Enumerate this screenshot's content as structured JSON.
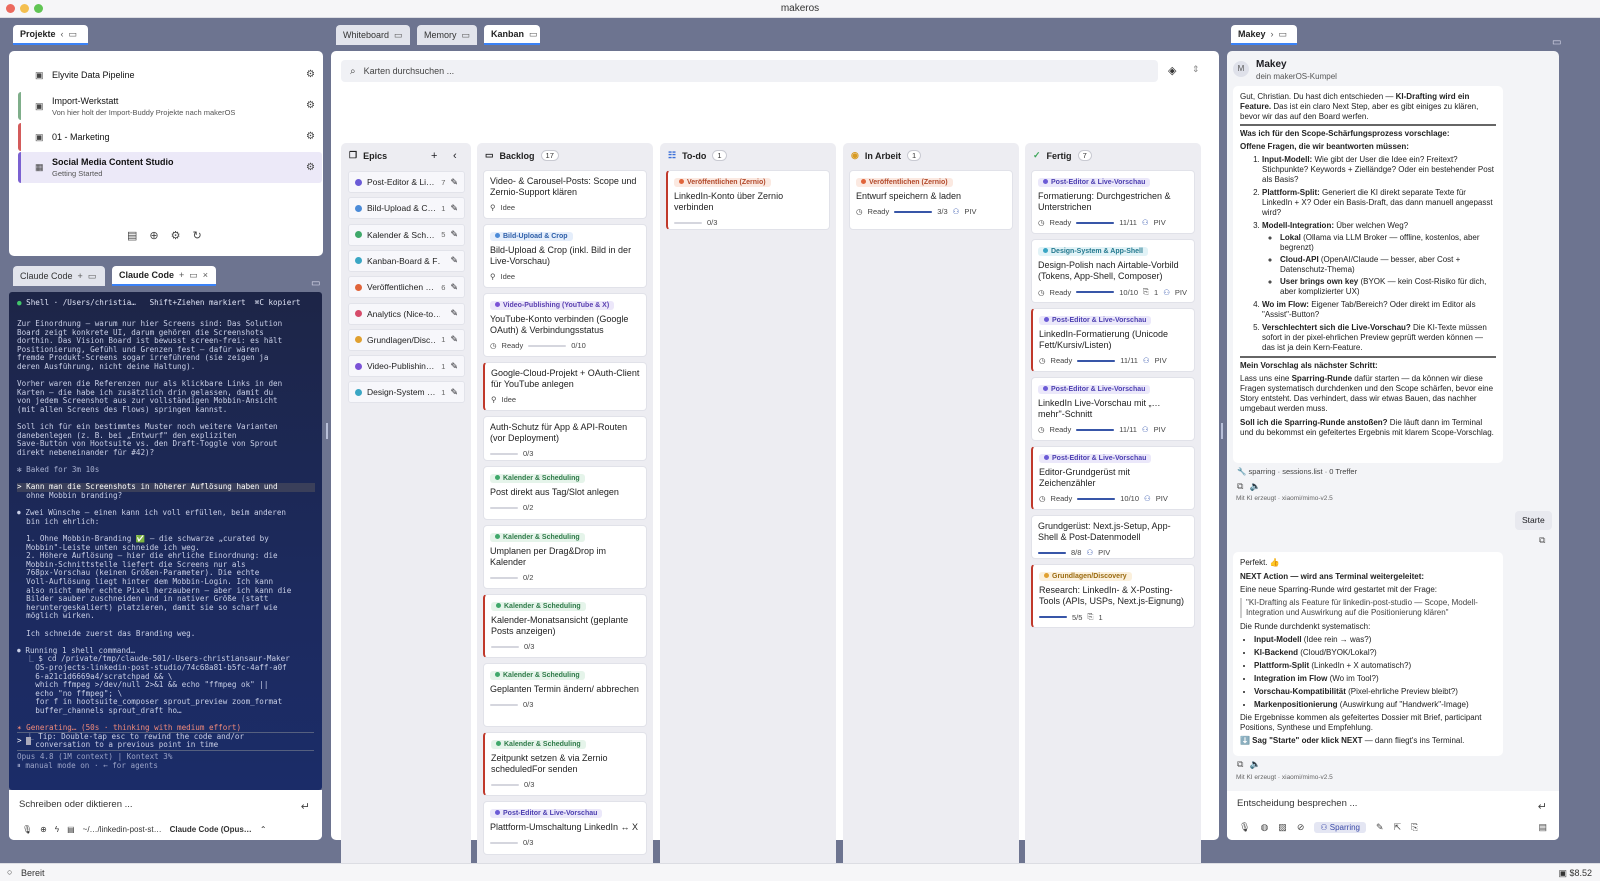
{
  "app": {
    "title": "makeros",
    "status": "Bereit",
    "cost": "$8.52"
  },
  "left": {
    "tab_label": "Projekte",
    "projects": [
      {
        "name": "Elyvite Data Pipeline",
        "sub": "",
        "color": ""
      },
      {
        "name": "Import-Werkstatt",
        "sub": "Von hier holt der Import-Buddy Projekte nach makerOS",
        "color": "#7fae8a"
      },
      {
        "name": "01 - Marketing",
        "sub": "",
        "color": "#d35b5b"
      },
      {
        "name": "Social Media Content Studio",
        "sub": "Getting Started",
        "color": "#7b61d1"
      }
    ],
    "term_tabs": [
      "Claude Code",
      "Claude Code"
    ],
    "terminal": {
      "header": "Shell · /Users/christia…   Shift+Ziehen markiert  ⌘C kopiert",
      "lines": [
        "Zur Einordnung — warum nur hier Screens sind: Das Solution",
        "Board zeigt konkrete UI, darum gehören die Screenshots",
        "dorthin. Das Vision Board ist bewusst screen-frei: es hält",
        "Positionierung, Gefühl und Grenzen fest — dafür wären",
        "fremde Produkt-Screens sogar irreführend (sie zeigen ja",
        "deren Ausführung, nicht deine Haltung).",
        "",
        "Vorher waren die Referenzen nur als klickbare Links in den",
        "Karten — die habe ich zusätzlich drin gelassen, damit du",
        "von jedem Screenshot aus zur vollständigen Mobbin-Ansicht",
        "(mit allen Screens des Flows) springen kannst.",
        "",
        "Soll ich für ein bestimmtes Muster noch weitere Varianten",
        "danebenlegen (z. B. bei „Entwurf\" den expliziten",
        "Save-Button von Hootsuite vs. den Draft-Toggle von Sprout",
        "direkt nebeneinander für #42)?",
        "",
        "✻ Baked for 3m 10s",
        "",
        "> Kann man die Screenshots in höherer Auflösung haben und",
        "  ohne Mobbin branding?",
        "",
        "⏺ Zwei Wünsche — einen kann ich voll erfüllen, beim anderen",
        "  bin ich ehrlich:",
        "",
        "  1. Ohne Mobbin-Branding ✅ — die schwarze „curated by",
        "  Mobbin\"-Leiste unten schneide ich weg.",
        "  2. Höhere Auflösung — hier die ehrliche Einordnung: die",
        "  Mobbin-Schnittstelle liefert die Screens nur als",
        "  768px-Vorschau (keinen Größen-Parameter). Die echte",
        "  Voll-Auflösung liegt hinter dem Mobbin-Login. Ich kann",
        "  also nicht mehr echte Pixel herzaubern — aber ich kann die",
        "  Bilder sauber zuschneiden und in nativer Größe (statt",
        "  heruntergeskaliert) platzieren, damit sie so scharf wie",
        "  möglich wirken.",
        "",
        "  Ich schneide zuerst das Branding weg.",
        "",
        "⏺ Running 1 shell command…",
        "  ⎿ $ cd /private/tmp/claude-501/-Users-christiansaur-Maker",
        "    OS-projects-linkedin-post-studio/74c68a81-b5fc-4aff-a0f",
        "    6-a21c1d6669a4/scratchpad && \\",
        "    which ffmpeg >/dev/null 2>&1 && echo \"ffmpeg ok\" ||",
        "    echo \"no ffmpeg\"; \\",
        "    for f in hootsuite_composer sprout_preview zoom_format",
        "    buffer_channels sprout_draft ho…",
        "",
        "✶ Generating… (50s · thinking with medium effort)",
        "  ⎿ Tip: Double-tap esc to rewind the code and/or",
        "    conversation to a previous point in time"
      ],
      "prompt": ">",
      "footer1": "Opus 4.8 (1M context) | Kontext 3%",
      "footer2": "⏸ manual mode on · ← for agents"
    },
    "input_placeholder": "Schreiben oder diktieren ...",
    "footer_path": "~/…/linkedin-post-st…",
    "footer_model": "Claude Code (Opus…"
  },
  "center": {
    "tabs": [
      "Whiteboard",
      "Memory",
      "Kanban"
    ],
    "search_placeholder": "Karten durchsuchen ...",
    "epics_title": "Epics",
    "epics": [
      {
        "name": "Post-Editor & Li…",
        "count": "7",
        "color": "#6b5bd6"
      },
      {
        "name": "Bild-Upload & C…",
        "count": "1",
        "color": "#4b8bd8"
      },
      {
        "name": "Kalender & Sch…",
        "count": "5",
        "color": "#3fa86a"
      },
      {
        "name": "Kanban-Board & F…",
        "count": "",
        "color": "#3aa6c4"
      },
      {
        "name": "Veröffentlichen …",
        "count": "6",
        "color": "#e0643a"
      },
      {
        "name": "Analytics (Nice-to…",
        "count": "",
        "color": "#d64b6a"
      },
      {
        "name": "Grundlagen/Disc…",
        "count": "1",
        "color": "#e0a030"
      },
      {
        "name": "Video-Publishin…",
        "count": "1",
        "color": "#7b52d6"
      },
      {
        "name": "Design-System …",
        "count": "1",
        "color": "#3aa6c4"
      }
    ],
    "columns": [
      {
        "title": "Backlog",
        "count": "17"
      },
      {
        "title": "To-do",
        "count": "1"
      },
      {
        "title": "In Arbeit",
        "count": "1"
      },
      {
        "title": "Fertig",
        "count": "7"
      }
    ],
    "backlog": [
      {
        "tag": "",
        "title": "Video- & Carousel-Posts: Scope und Zernio-Support klären",
        "meta": "Idee",
        "progress": ""
      },
      {
        "tag": "Bild-Upload & Crop",
        "title": "Bild-Upload & Crop (inkl. Bild in der Live-Vorschau)",
        "meta": "Idee",
        "progress": ""
      },
      {
        "tag": "Video-Publishing (YouTube & X)",
        "title": "YouTube-Konto verbinden (Google OAuth) & Verbindungsstatus",
        "meta": "Ready",
        "progress": "0/10"
      },
      {
        "tag": "",
        "title": "Google-Cloud-Projekt + OAuth-Client für YouTube anlegen",
        "meta": "Idee",
        "progress": ""
      },
      {
        "tag": "",
        "title": "Auth-Schutz für App & API-Routen (vor Deployment)",
        "meta": "",
        "progress": "0/3"
      },
      {
        "tag": "Kalender & Scheduling",
        "title": "Post direkt aus Tag/Slot anlegen",
        "meta": "",
        "progress": "0/2"
      },
      {
        "tag": "Kalender & Scheduling",
        "title": "Umplanen per Drag&Drop im Kalender",
        "meta": "",
        "progress": "0/2"
      },
      {
        "tag": "Kalender & Scheduling",
        "title": "Kalender-Monatsansicht (geplante Posts anzeigen)",
        "meta": "",
        "progress": "0/3"
      },
      {
        "tag": "Kalender & Scheduling",
        "title": "Geplanten Termin ändern/ abbrechen",
        "meta": "",
        "progress": "0/3"
      },
      {
        "tag": "Kalender & Scheduling",
        "title": "Zeitpunkt setzen & via Zernio scheduledFor senden",
        "meta": "",
        "progress": "0/3"
      },
      {
        "tag": "Post-Editor & Live-Vorschau",
        "title": "Plattform-Umschaltung LinkedIn ↔ X",
        "meta": "",
        "progress": "0/3"
      }
    ],
    "todo": [
      {
        "tag": "Veröffentlichen (Zernio)",
        "title": "LinkedIn-Konto über Zernio verbinden",
        "meta": "",
        "progress": "0/3"
      }
    ],
    "inarbeit": [
      {
        "tag": "Veröffentlichen (Zernio)",
        "title": "Entwurf speichern & laden",
        "meta": "Ready",
        "progress": "3/3",
        "extra": "PIV"
      }
    ],
    "fertig": [
      {
        "tag": "Post-Editor & Live-Vorschau",
        "title": "Formatierung: Durchgestrichen & Unterstrichen",
        "meta": "Ready",
        "progress": "11/11",
        "extra": "PIV"
      },
      {
        "tag": "Design-System & App-Shell",
        "title": "Design-Polish nach Airtable-Vorbild (Tokens, App-Shell, Composer)",
        "meta": "Ready",
        "progress": "10/10",
        "attach": "1",
        "extra": "PIV"
      },
      {
        "tag": "Post-Editor & Live-Vorschau",
        "title": "LinkedIn-Formatierung (Unicode Fett/Kursiv/Listen)",
        "meta": "Ready",
        "progress": "11/11",
        "extra": "PIV"
      },
      {
        "tag": "Post-Editor & Live-Vorschau",
        "title": "LinkedIn Live-Vorschau mit „… mehr\"-Schnitt",
        "meta": "Ready",
        "progress": "11/11",
        "extra": "PIV"
      },
      {
        "tag": "Post-Editor & Live-Vorschau",
        "title": "Editor-Grundgerüst mit Zeichenzähler",
        "meta": "Ready",
        "progress": "10/10",
        "extra": "PIV"
      },
      {
        "tag": "",
        "title": "Grundgerüst: Next.js-Setup, App-Shell & Post-Datenmodell",
        "meta": "",
        "progress": "8/8",
        "extra": "PIV"
      },
      {
        "tag": "Grundlagen/Discovery",
        "title": "Research: LinkedIn- & X-Posting-Tools (APIs, USPs, Next.js-Eignung)",
        "meta": "",
        "progress": "5/5",
        "attach": "1"
      }
    ]
  },
  "right": {
    "tab_label": "Makey",
    "name": "Makey",
    "subtitle": "dein makerOS-Kumpel",
    "avatar": "M",
    "msg1": {
      "intro_a": "Gut, Christian. Du hast dich entschieden — ",
      "intro_b": "KI-Drafting wird ein Feature.",
      "intro_c": " Das ist ein claro Next Step, aber es gibt einiges zu klären, bevor wir das auf den Board werfen.",
      "h1": "Was ich für den Scope-Schärfungsprozess vorschlage:",
      "h2": "Offene Fragen, die wir beantworten müssen:",
      "q1_b": "Input-Modell:",
      "q1": " Wie gibt der User die Idee ein? Freitext? Stichpunkte? Keywords + Zielländge? Oder ein bestehender Post als Basis?",
      "q2_b": "Plattform-Split:",
      "q2": " Generiert die KI direkt separate Texte für LinkedIn + X? Oder ein Basis-Draft, das dann manuell angepasst wird?",
      "q3_b": "Modell-Integration:",
      "q3": " Über welchen Weg?",
      "s1_b": "Lokal",
      "s1": " (Ollama via LLM Broker — offline, kostenlos, aber begrenzt)",
      "s2_b": "Cloud-API",
      "s2": " (OpenAI/Claude — besser, aber Cost + Datenschutz-Thema)",
      "s3_b": "User brings own key",
      "s3": " (BYOK — kein Cost-Risiko für dich, aber komplizierter UX)",
      "q4_b": "Wo im Flow:",
      "q4": " Eigener Tab/Bereich? Oder direkt im Editor als \"Assist\"-Button?",
      "q5_b": "Verschlechtert sich die Live-Vorschau?",
      "q5": " Die KI-Texte müssen sofort in der pixel-ehrlichen Preview geprüft werden können — das ist ja dein Kern-Feature.",
      "h3": "Mein Vorschlag als nächster Schritt:",
      "p1_a": "Lass uns eine ",
      "p1_b": "Sparring-Runde",
      "p1_c": " dafür starten — da können wir diese Fragen systematisch durchdenken und den Scope schärfen, bevor eine Story entsteht. Das verhindert, dass wir etwas Bauen, das nachher umgebaut werden muss.",
      "p2_b": "Soll ich die Sparring-Runde anstoßen?",
      "p2": " Die läuft dann im Terminal und du bekommst ein gefeitertes Ergebnis mit klarem Scope-Vorschlag.",
      "tool": "sparring · sessions.list · 0 Treffer",
      "foot": "Mit KI erzeugt · xiaomi/mimo-v2.5"
    },
    "user_msg": "Starte",
    "msg2": {
      "l1": "Perfekt. 👍",
      "h1": "NEXT Action — wird ans Terminal weitergeleitet:",
      "l2": "Eine neue Sparring-Runde wird gestartet mit der Frage:",
      "quote": "\"KI-Drafting als Feature für linkedin-post-studio — Scope, Modell-Integration und Auswirkung auf die Positionierung klären\"",
      "l3": "Die Runde durchdenkt systematisch:",
      "b1_b": "Input-Modell",
      "b1": " (Idee rein → was?)",
      "b2_b": "KI-Backend",
      "b2": " (Cloud/BYOK/Lokal?)",
      "b3_b": "Plattform-Split",
      "b3": " (LinkedIn + X automatisch?)",
      "b4_b": "Integration im Flow",
      "b4": " (Wo im Tool?)",
      "b5_b": "Vorschau-Kompatibilität",
      "b5": " (Pixel-ehrliche Preview bleibt?)",
      "b6_b": "Markenpositionierung",
      "b6": " (Auswirkung auf \"Handwerk\"-Image)",
      "l4": "Die Ergebnisse kommen als gefeitertes Dossier mit Brief, participant Positions, Synthese und Empfehlung.",
      "l5_b": "⬇️ Sag \"Starte\" oder klick NEXT",
      "l5": " — dann fliegt's ins Terminal.",
      "foot": "Mit KI erzeugt · xiaomi/mimo-v2.5"
    },
    "input_placeholder": "Entscheidung besprechen ...",
    "sparring_chip": "Sparring"
  }
}
